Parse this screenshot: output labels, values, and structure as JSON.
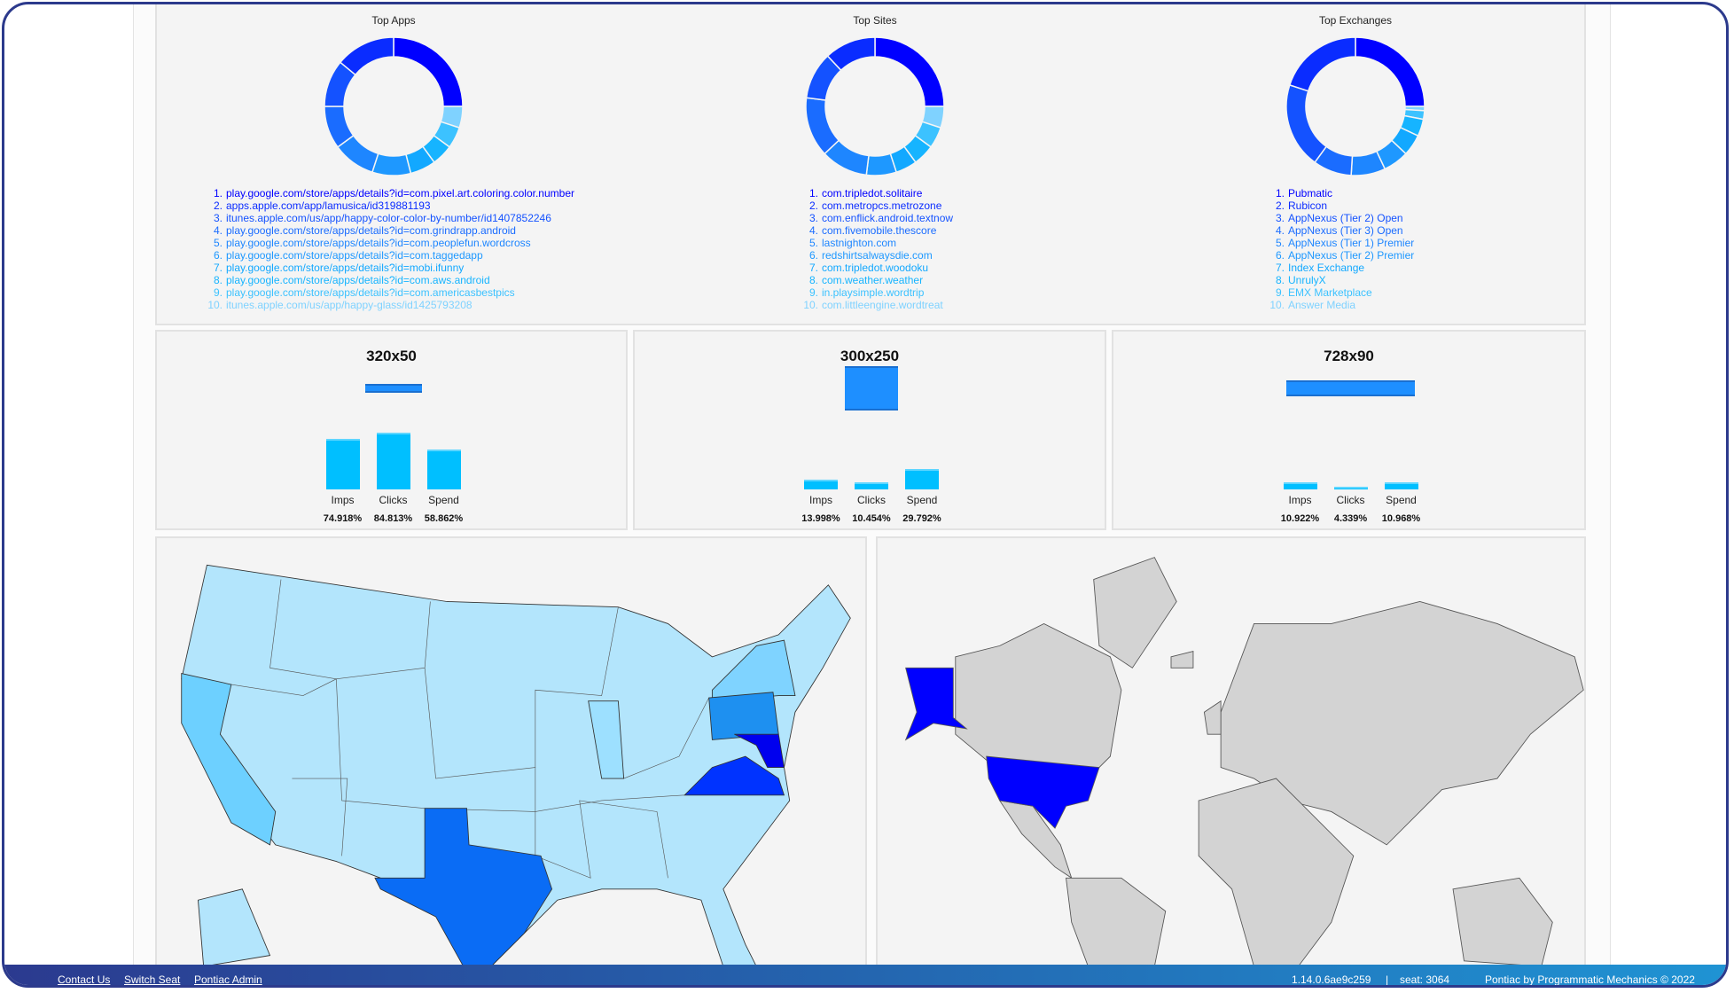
{
  "palette": [
    "#0000ff",
    "#0a2cff",
    "#1452ff",
    "#1a6cff",
    "#1e86ff",
    "#1e98ff",
    "#12a8ff",
    "#16b4ff",
    "#3cc2ff",
    "#7fd2ff"
  ],
  "top_panels": [
    {
      "title": "Top Apps",
      "shares": [
        25,
        14,
        11,
        10,
        10,
        9,
        6,
        5,
        5,
        5
      ],
      "items": [
        "play.google.com/store/apps/details?id=com.pixel.art.coloring.color.number",
        "apps.apple.com/app/lamusica/id319881193",
        "itunes.apple.com/us/app/happy-color-color-by-number/id1407852246",
        "play.google.com/store/apps/details?id=com.grindrapp.android",
        "play.google.com/store/apps/details?id=com.peoplefun.wordcross",
        "play.google.com/store/apps/details?id=com.taggedapp",
        "play.google.com/store/apps/details?id=mobi.ifunny",
        "play.google.com/store/apps/details?id=com.aws.android",
        "play.google.com/store/apps/details?id=com.americasbestpics",
        "itunes.apple.com/us/app/happy-glass/id1425793208"
      ]
    },
    {
      "title": "Top Sites",
      "shares": [
        25,
        12,
        11,
        14,
        11,
        7,
        5,
        5,
        5,
        5
      ],
      "items": [
        "com.tripledot.solitaire",
        "com.metropcs.metrozone",
        "com.enflick.android.textnow",
        "com.fivemobile.thescore",
        "lastnighton.com",
        "redshirtsalwaysdie.com",
        "com.tripledot.woodoku",
        "com.weather.weather",
        "in.playsimple.wordtrip",
        "com.littleengine.wordtreat"
      ]
    },
    {
      "title": "Top Exchanges",
      "shares": [
        25,
        20,
        20,
        9,
        8,
        6,
        5,
        4,
        2,
        1
      ],
      "items": [
        "Pubmatic",
        "Rubicon",
        "AppNexus (Tier 2) Open",
        "AppNexus (Tier 3) Open",
        "AppNexus (Tier 1) Premier",
        "AppNexus (Tier 2) Premier",
        "Index Exchange",
        "UnrulyX",
        "EMX Marketplace",
        "Answer Media"
      ]
    }
  ],
  "chart_data": [
    {
      "type": "bar",
      "title": "320x50",
      "ad_width": 320,
      "ad_height": 50,
      "categories": [
        "Imps",
        "Clicks",
        "Spend"
      ],
      "values": [
        74.918,
        84.813,
        58.862
      ],
      "labels": [
        "74.918%",
        "84.813%",
        "58.862%"
      ],
      "ylim": [
        0,
        100
      ]
    },
    {
      "type": "bar",
      "title": "300x250",
      "ad_width": 300,
      "ad_height": 250,
      "categories": [
        "Imps",
        "Clicks",
        "Spend"
      ],
      "values": [
        13.998,
        10.454,
        29.792
      ],
      "labels": [
        "13.998%",
        "10.454%",
        "29.792%"
      ],
      "ylim": [
        0,
        100
      ]
    },
    {
      "type": "bar",
      "title": "728x90",
      "ad_width": 728,
      "ad_height": 90,
      "categories": [
        "Imps",
        "Clicks",
        "Spend"
      ],
      "values": [
        10.922,
        4.339,
        10.968
      ],
      "labels": [
        "10.922%",
        "4.339%",
        "10.968%"
      ],
      "ylim": [
        0,
        100
      ]
    }
  ],
  "maps": {
    "us_base_color": "#b3e5fc",
    "highlighted_states": {
      "Texas": "#0a6cf5",
      "Virginia": "#0033ff",
      "Maryland": "#0000ee",
      "Pennsylvania": "#1e90f0",
      "New York": "#7fd3ff",
      "California": "#6dd0ff",
      "Illinois": "#9de0ff"
    },
    "world_base_color": "#d3d3d3",
    "highlighted_countries": {
      "United States": "#0000ff"
    }
  },
  "footer": {
    "links": [
      "Contact Us",
      "Switch Seat",
      "Pontiac Admin"
    ],
    "version": "1.14.0.6ae9c259",
    "separator": "|",
    "seat": "seat: 3064",
    "copyright": "Pontiac by Programmatic Mechanics © 2022"
  }
}
